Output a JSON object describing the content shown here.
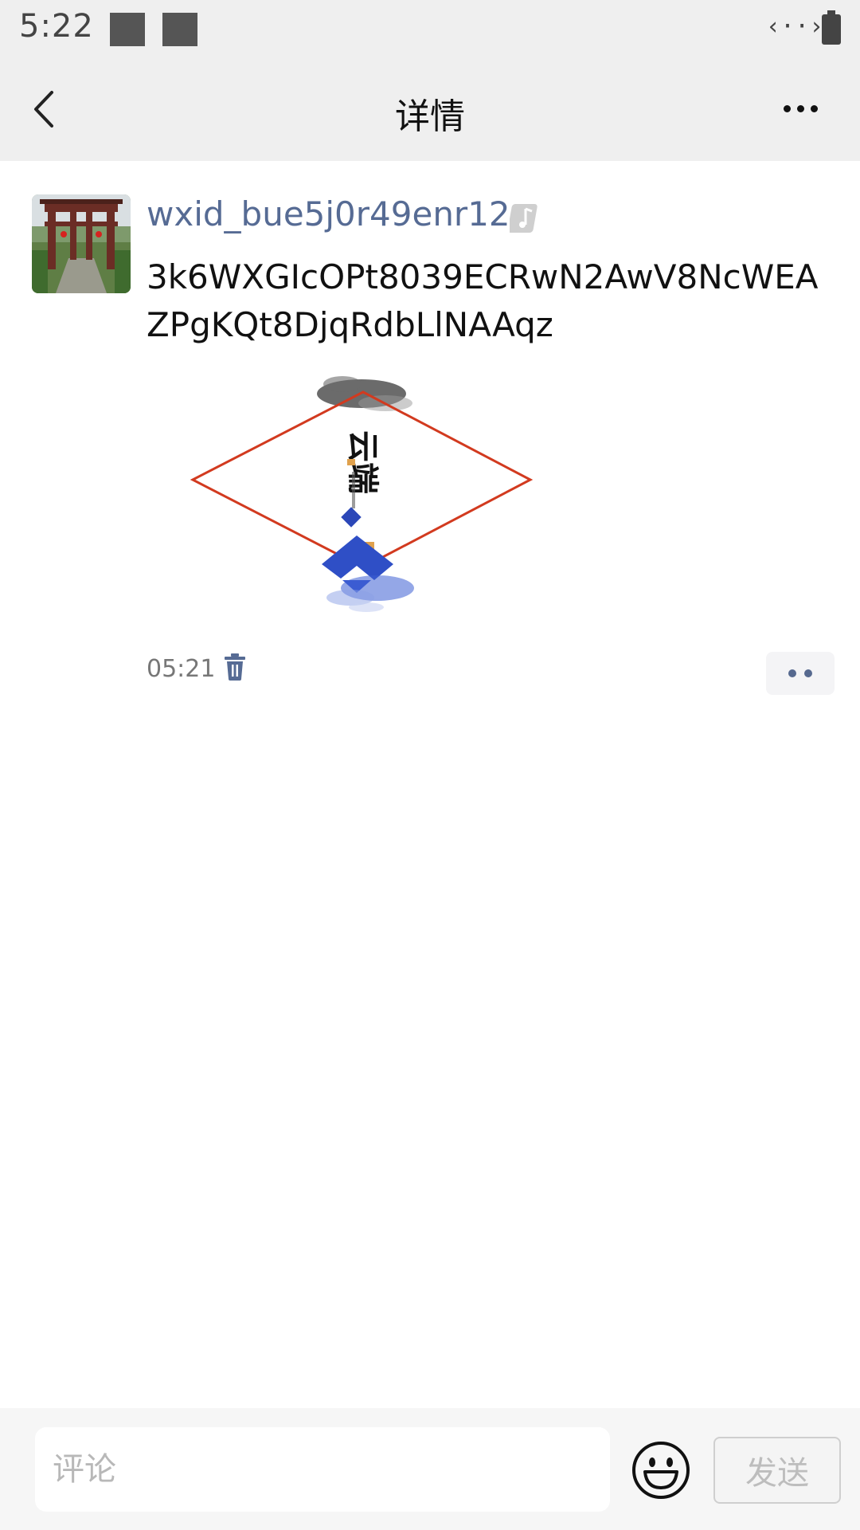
{
  "status_bar": {
    "time": "5:22",
    "network_icon": "data-transfer-icon",
    "battery_icon": "battery-icon"
  },
  "app_bar": {
    "title": "详情",
    "back_icon": "chevron-left-icon",
    "more_icon": "more-horizontal-icon"
  },
  "post": {
    "username": "wxid_bue5j0r49enr12",
    "username_color": "#566b94",
    "tag_icon": "music-note-icon",
    "text": "3k6WXGIcOPt8039ECRwN2AwV8NcWEAZPgKQt8DjqRdbLlNAAqz",
    "image_text": "云端",
    "time": "05:21",
    "delete_icon": "trash-icon",
    "comment_icon": "comment-dots-icon"
  },
  "footer": {
    "comment_placeholder": "评论",
    "emoji_icon": "smiley-icon",
    "send_label": "发送"
  }
}
